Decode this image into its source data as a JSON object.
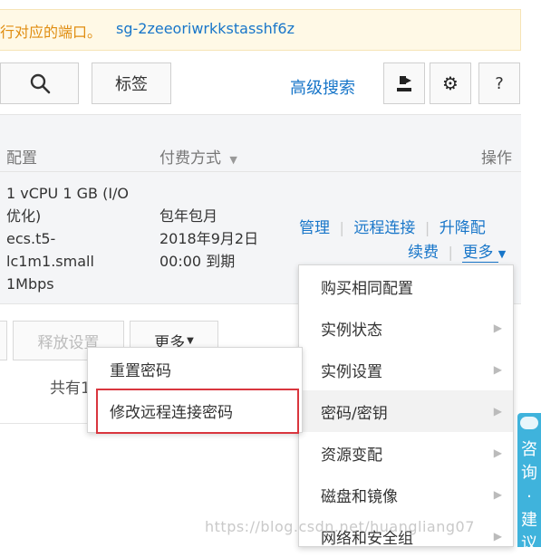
{
  "notice": {
    "text": "行对应的端口。",
    "group_id": "sg-2zeeoriwrkkstasshf6z"
  },
  "toolbar": {
    "search_icon": "search-icon",
    "tag_label": "标签",
    "advanced_search": "高级搜索",
    "export_icon": "export-icon",
    "settings_icon": "gear-icon",
    "help_label": "?"
  },
  "table": {
    "headers": {
      "config": "配置",
      "billing": "付费方式",
      "actions": "操作"
    },
    "row": {
      "config_lines": [
        "1 vCPU 1 GB (I/O",
        "优化)",
        "ecs.t5-",
        "lc1m1.small",
        "1Mbps"
      ],
      "billing_lines": [
        "包年包月",
        "2018年9月2日",
        "00:00 到期"
      ],
      "actions": {
        "manage": "管理",
        "remote": "远程连接",
        "resize": "升降配",
        "renew": "续费",
        "more": "更多"
      }
    }
  },
  "bottom": {
    "release_settings": "释放设置",
    "more": "更多",
    "total_prefix": "共有1"
  },
  "password_menu": {
    "items": [
      "重置密码",
      "修改远程连接密码"
    ]
  },
  "more_menu": {
    "items": [
      "购买相同配置",
      "实例状态",
      "实例设置",
      "密码/密钥",
      "资源变配",
      "磁盘和镜像",
      "网络和安全组"
    ]
  },
  "side_tab": {
    "chars": [
      "咨",
      "询",
      "·",
      "建",
      "议"
    ]
  },
  "watermark": "https://blog.csdn.net/huangliang07"
}
